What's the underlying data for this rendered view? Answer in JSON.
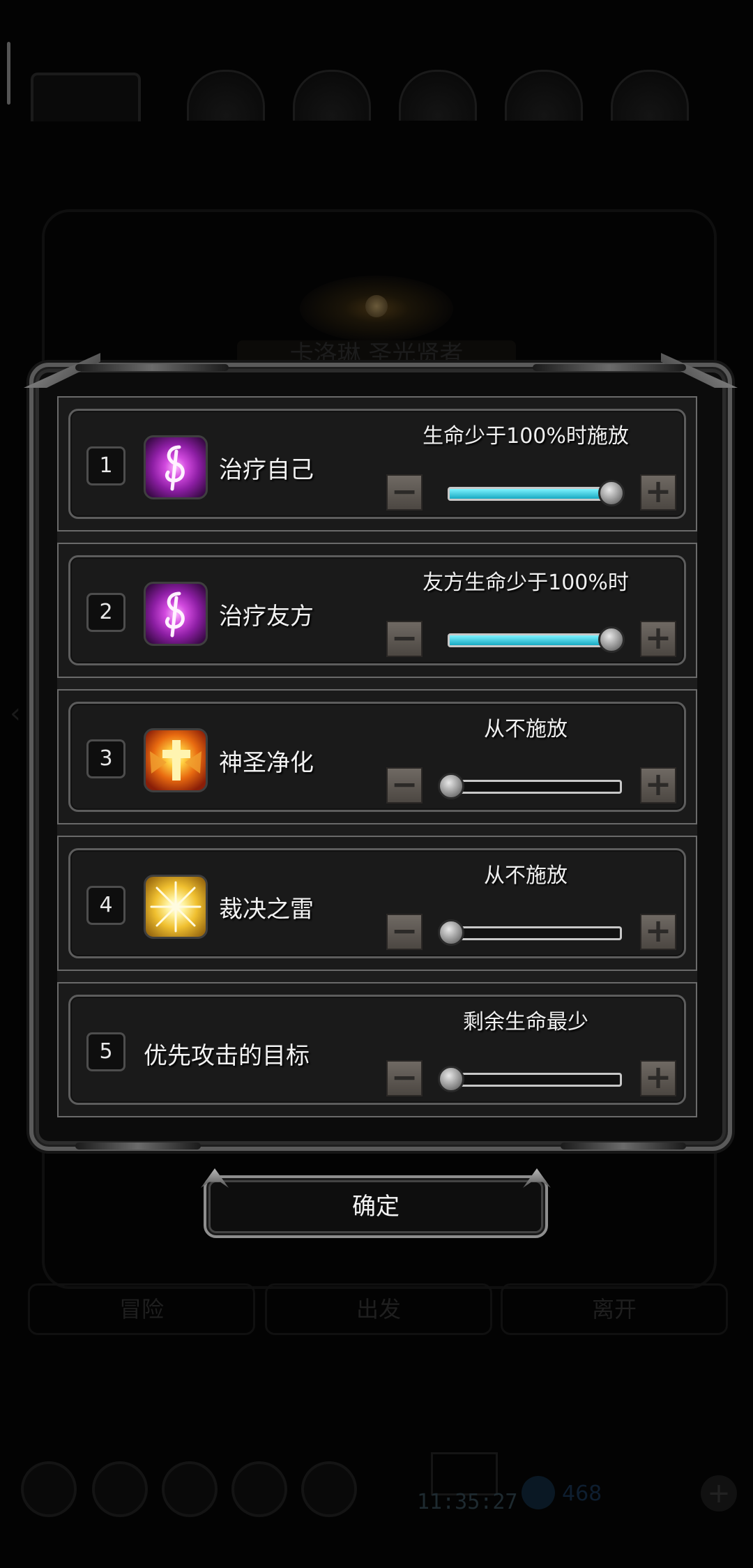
{
  "background": {
    "title": "卡洛琳 圣光贤者",
    "nav": [
      "冒险",
      "出发",
      "离开"
    ],
    "clock": "11:35:27",
    "currency": "468"
  },
  "rows": [
    {
      "number": "1",
      "skill": "治疗自己",
      "icon": "heal-skill-icon",
      "condition": "生命少于100%时施放",
      "slider_percent": 100
    },
    {
      "number": "2",
      "skill": "治疗友方",
      "icon": "heal-skill-icon",
      "condition": "友方生命少于100%时",
      "slider_percent": 100
    },
    {
      "number": "3",
      "skill": "神圣净化",
      "icon": "holy-purify-icon",
      "condition": "从不施放",
      "slider_percent": 0
    },
    {
      "number": "4",
      "skill": "裁决之雷",
      "icon": "thunder-icon",
      "condition": "从不施放",
      "slider_percent": 0
    },
    {
      "number": "5",
      "skill": "优先攻击的目标",
      "icon": "",
      "condition": "剩余生命最少",
      "slider_percent": 0
    }
  ],
  "buttons": {
    "minus": "−",
    "plus": "+",
    "confirm": "确定"
  },
  "colors": {
    "slider_fill": "#2fc7dc",
    "panel": "#1a1a1a",
    "border": "#6a6a6a"
  }
}
